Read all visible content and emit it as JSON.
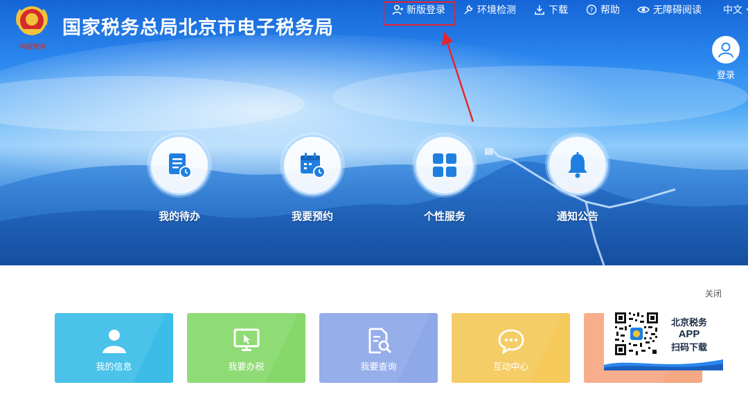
{
  "header": {
    "site_title": "国家税务总局北京市电子税务局",
    "logo_caption": "中国税务"
  },
  "topnav": {
    "items": [
      {
        "label": "新版登录",
        "icon": "user-plus-icon"
      },
      {
        "label": "环境检测",
        "icon": "wrench-icon"
      },
      {
        "label": "下载",
        "icon": "download-icon"
      },
      {
        "label": "帮助",
        "icon": "help-circle-icon"
      },
      {
        "label": "无障碍阅读",
        "icon": "eye-icon"
      },
      {
        "label": "中文",
        "icon": "chevron-down-icon"
      }
    ]
  },
  "login": {
    "label": "登录"
  },
  "features": [
    {
      "label": "我的待办",
      "icon": "todo-icon"
    },
    {
      "label": "我要预约",
      "icon": "calendar-icon"
    },
    {
      "label": "个性服务",
      "icon": "grid-icon"
    },
    {
      "label": "通知公告",
      "icon": "bell-icon"
    }
  ],
  "close_label": "关闭",
  "tiles": [
    {
      "label": "我的信息",
      "color": "#3bbde8",
      "icon": "person-icon"
    },
    {
      "label": "我要办税",
      "color": "#86d86a",
      "icon": "monitor-icon"
    },
    {
      "label": "我要查询",
      "color": "#8ea8e8",
      "icon": "document-search-icon"
    },
    {
      "label": "互动中心",
      "color": "#f5c95a",
      "icon": "chat-icon"
    },
    {
      "label": "",
      "color": "#f6a883",
      "icon": ""
    }
  ],
  "qr_promo": {
    "line1": "北京税务",
    "line2": "APP",
    "line3": "扫码下载"
  },
  "colors": {
    "highlight": "#e8242c",
    "brand_blue": "#2a86ee"
  }
}
